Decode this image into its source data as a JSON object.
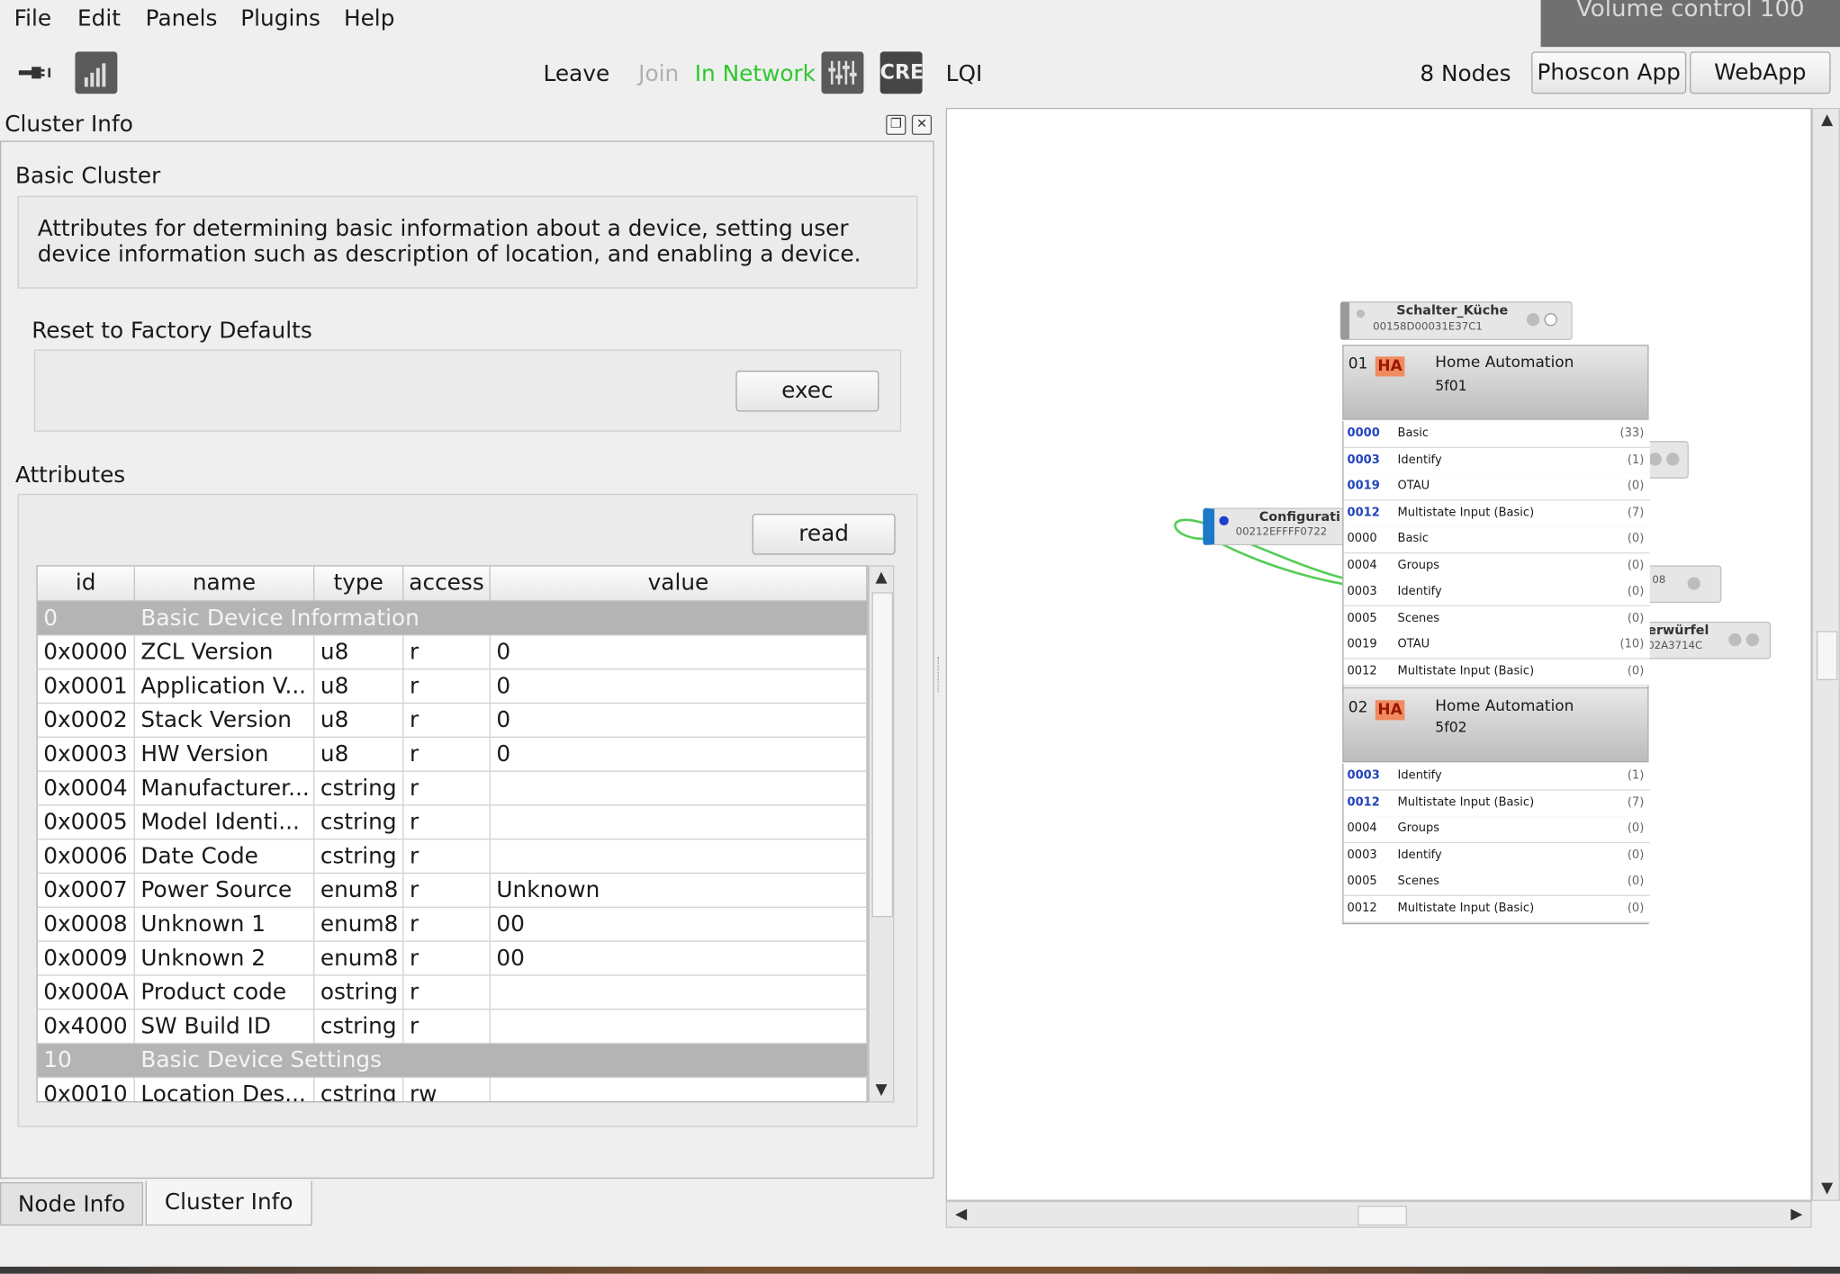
{
  "menubar": {
    "items": [
      {
        "label": "File"
      },
      {
        "label": "Edit"
      },
      {
        "label": "Panels"
      },
      {
        "label": "Plugins"
      },
      {
        "label": "Help"
      }
    ],
    "volume_osd": "Volume control 100"
  },
  "toolbar": {
    "leave": "Leave",
    "join": "Join",
    "status": "In Network",
    "cre": "CRE",
    "lqi": "LQI",
    "nodes": "8 Nodes",
    "phoscon": "Phoscon App",
    "webapp": "WebApp",
    "colors": {
      "status": "#2ec82e",
      "join": "#b0b0b0"
    }
  },
  "dock": {
    "title": "Cluster Info",
    "cluster_name": "Basic Cluster",
    "description": "Attributes for determining basic information about a device, setting user device information such as description of location, and enabling a device.",
    "reset_label": "Reset to Factory Defaults",
    "exec_button": "exec",
    "attributes_label": "Attributes",
    "read_button": "read",
    "columns": [
      "id",
      "name",
      "type",
      "access",
      "value"
    ],
    "groups": [
      {
        "id": "0",
        "name": "Basic Device Information",
        "rows": [
          {
            "id": "0x0000",
            "name": "ZCL Version",
            "type": "u8",
            "access": "r",
            "value": "0"
          },
          {
            "id": "0x0001",
            "name": "Application V...",
            "type": "u8",
            "access": "r",
            "value": "0"
          },
          {
            "id": "0x0002",
            "name": "Stack Version",
            "type": "u8",
            "access": "r",
            "value": "0"
          },
          {
            "id": "0x0003",
            "name": "HW Version",
            "type": "u8",
            "access": "r",
            "value": "0"
          },
          {
            "id": "0x0004",
            "name": "Manufacturer...",
            "type": "cstring",
            "access": "r",
            "value": ""
          },
          {
            "id": "0x0005",
            "name": "Model Identi...",
            "type": "cstring",
            "access": "r",
            "value": ""
          },
          {
            "id": "0x0006",
            "name": "Date Code",
            "type": "cstring",
            "access": "r",
            "value": ""
          },
          {
            "id": "0x0007",
            "name": "Power Source",
            "type": "enum8",
            "access": "r",
            "value": "Unknown"
          },
          {
            "id": "0x0008",
            "name": "Unknown 1",
            "type": "enum8",
            "access": "r",
            "value": "00"
          },
          {
            "id": "0x0009",
            "name": "Unknown 2",
            "type": "enum8",
            "access": "r",
            "value": "00"
          },
          {
            "id": "0x000A",
            "name": "Product code",
            "type": "ostring",
            "access": "r",
            "value": ""
          },
          {
            "id": "0x4000",
            "name": "SW Build ID",
            "type": "cstring",
            "access": "r",
            "value": ""
          }
        ]
      },
      {
        "id": "10",
        "name": "Basic Device Settings",
        "rows": [
          {
            "id": "0x0010",
            "name": "Location Des...",
            "type": "cstring",
            "access": "rw",
            "value": ""
          }
        ]
      }
    ],
    "tabs": [
      {
        "label": "Node Info"
      },
      {
        "label": "Cluster Info"
      }
    ]
  },
  "canvas": {
    "node_top": {
      "name": "Schalter_Küche",
      "mac": "00158D00031E37C1"
    },
    "node_config": {
      "name": "Configurati",
      "mac": "00212EFFFF0722"
    },
    "node_right1_mac": "08",
    "node_right2": {
      "name": "erwürfel",
      "mac": "02A3714C"
    },
    "endpoints": [
      {
        "ep": "01",
        "badge": "HA",
        "profile": "Home Automation",
        "device": "5f01",
        "clusters": [
          {
            "id": "0000",
            "name": "Basic",
            "count": "(33)",
            "server": true
          },
          {
            "id": "0003",
            "name": "Identify",
            "count": "(1)",
            "server": true
          },
          {
            "id": "0019",
            "name": "OTAU",
            "count": "(0)",
            "server": true
          },
          {
            "id": "0012",
            "name": "Multistate Input (Basic)",
            "count": "(7)",
            "server": true
          },
          {
            "id": "0000",
            "name": "Basic",
            "count": "(0)",
            "server": false
          },
          {
            "id": "0004",
            "name": "Groups",
            "count": "(0)",
            "server": false
          },
          {
            "id": "0003",
            "name": "Identify",
            "count": "(0)",
            "server": false
          },
          {
            "id": "0005",
            "name": "Scenes",
            "count": "(0)",
            "server": false
          },
          {
            "id": "0019",
            "name": "OTAU",
            "count": "(10)",
            "server": false
          },
          {
            "id": "0012",
            "name": "Multistate Input (Basic)",
            "count": "(0)",
            "server": false
          }
        ]
      },
      {
        "ep": "02",
        "badge": "HA",
        "profile": "Home Automation",
        "device": "5f02",
        "clusters": [
          {
            "id": "0003",
            "name": "Identify",
            "count": "(1)",
            "server": true
          },
          {
            "id": "0012",
            "name": "Multistate Input (Basic)",
            "count": "(7)",
            "server": true
          },
          {
            "id": "0004",
            "name": "Groups",
            "count": "(0)",
            "server": false
          },
          {
            "id": "0003",
            "name": "Identify",
            "count": "(0)",
            "server": false
          },
          {
            "id": "0005",
            "name": "Scenes",
            "count": "(0)",
            "server": false
          },
          {
            "id": "0012",
            "name": "Multistate Input (Basic)",
            "count": "(0)",
            "server": false
          }
        ]
      }
    ]
  }
}
